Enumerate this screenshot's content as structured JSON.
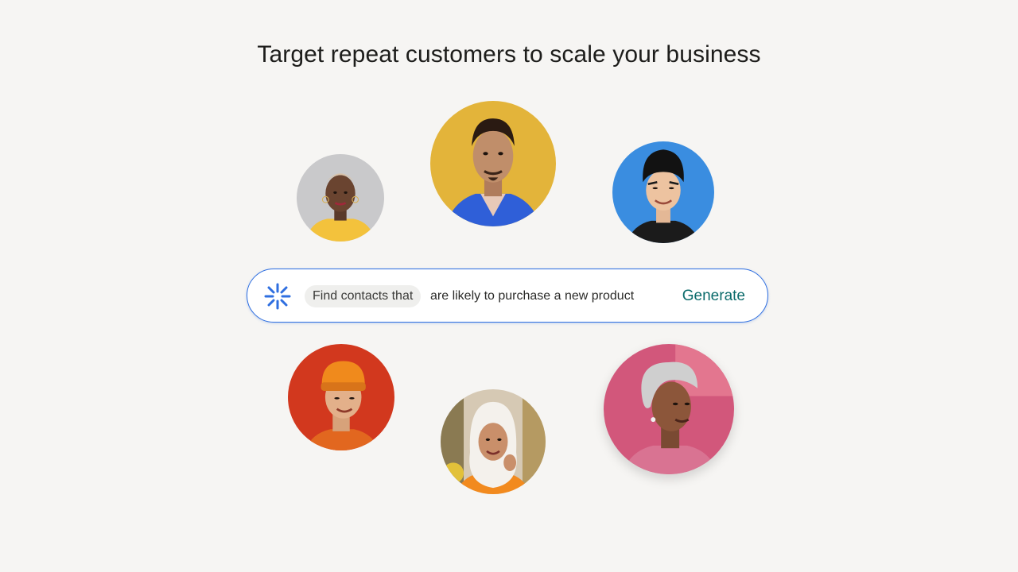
{
  "headline": "Target repeat customers to scale your business",
  "avatars": [
    {
      "name": "avatar-woman-yellow-top",
      "background": "#c9c9cb"
    },
    {
      "name": "avatar-man-blue-jacket",
      "background": "#e3b43a"
    },
    {
      "name": "avatar-man-black-cap",
      "background": "#3a8de0"
    },
    {
      "name": "avatar-man-orange-beanie",
      "background": "#d2381e"
    },
    {
      "name": "avatar-woman-white-hijab",
      "background": "#d6c9b4"
    },
    {
      "name": "avatar-woman-grey-hair",
      "background": "#d2577b"
    }
  ],
  "search": {
    "icon": "sparkle-icon",
    "chip_label": "Find contacts that",
    "prompt": "are likely to purchase a new product",
    "generate_label": "Generate"
  },
  "colors": {
    "background": "#f6f5f3",
    "accent_blue": "#2f6fe0",
    "generate_teal": "#0b6b6b"
  }
}
